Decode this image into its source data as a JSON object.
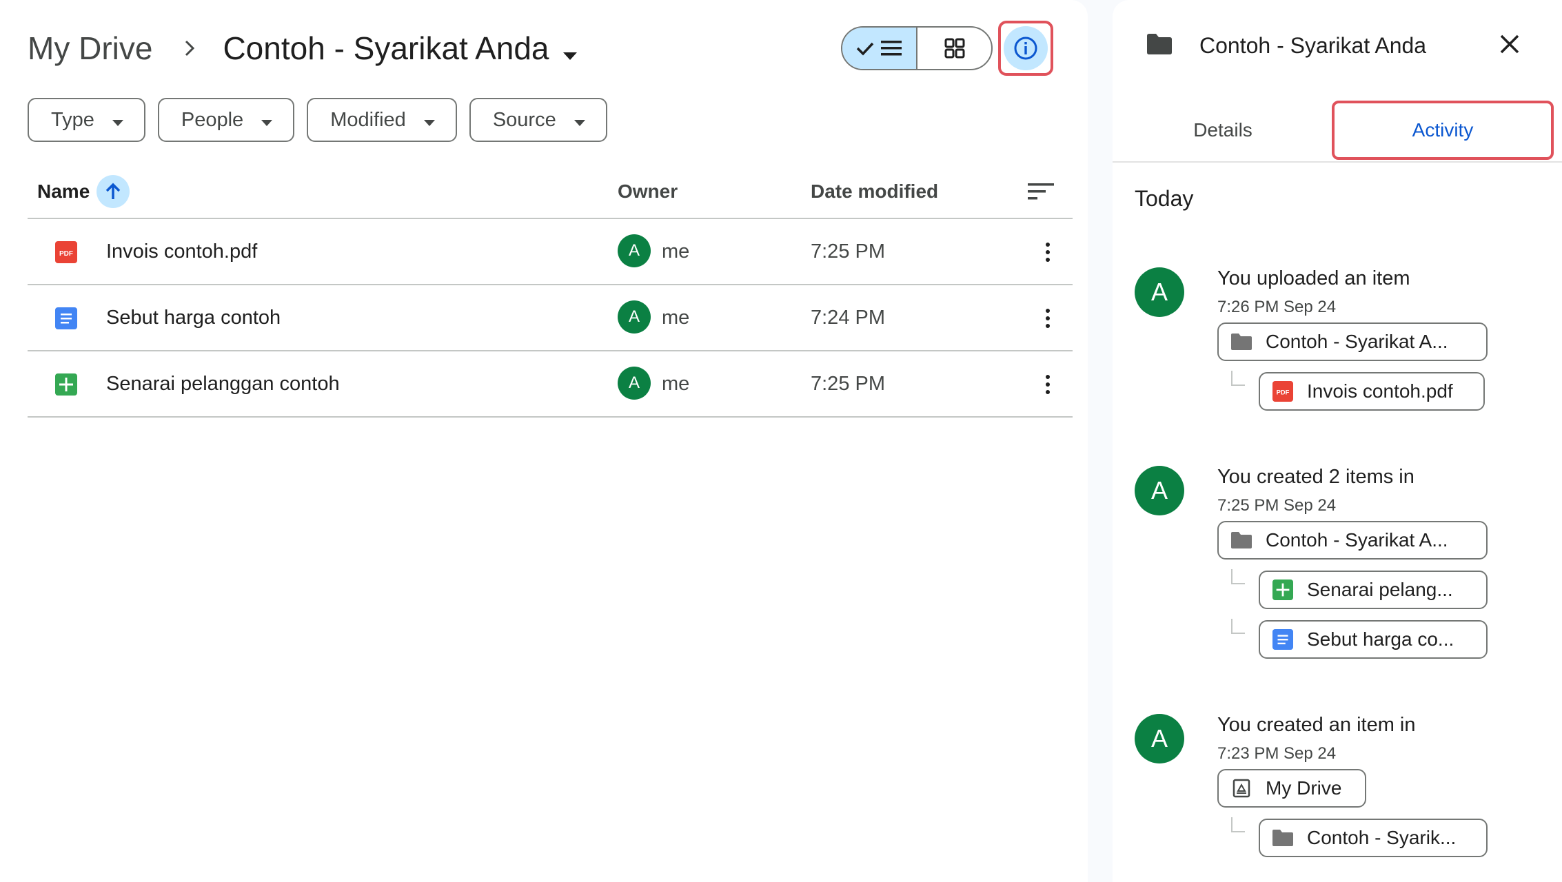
{
  "breadcrumb": {
    "root": "My Drive",
    "current": "Contoh - Syarikat Anda"
  },
  "filters": [
    "Type",
    "People",
    "Modified",
    "Source"
  ],
  "columns": {
    "name": "Name",
    "owner": "Owner",
    "date_modified": "Date modified"
  },
  "files": [
    {
      "name": "Invois contoh.pdf",
      "type": "pdf",
      "owner_initial": "A",
      "owner": "me",
      "modified": "7:25 PM"
    },
    {
      "name": "Sebut harga contoh",
      "type": "docs",
      "owner_initial": "A",
      "owner": "me",
      "modified": "7:24 PM"
    },
    {
      "name": "Senarai pelanggan contoh",
      "type": "sheets",
      "owner_initial": "A",
      "owner": "me",
      "modified": "7:25 PM"
    }
  ],
  "panel": {
    "title": "Contoh - Syarikat Anda",
    "tabs": {
      "details": "Details",
      "activity": "Activity"
    },
    "section_label": "Today",
    "activities": [
      {
        "avatar": "A",
        "title": "You uploaded an item",
        "time": "7:26 PM Sep 24",
        "parent": {
          "label": "Contoh - Syarikat A...",
          "icon": "folder-icon"
        },
        "children": [
          {
            "label": "Invois contoh.pdf",
            "icon": "pdf-icon"
          }
        ]
      },
      {
        "avatar": "A",
        "title": "You created 2 items in",
        "time": "7:25 PM Sep 24",
        "parent": {
          "label": "Contoh - Syarikat A...",
          "icon": "folder-icon"
        },
        "children": [
          {
            "label": "Senarai pelang...",
            "icon": "sheets-icon"
          },
          {
            "label": "Sebut harga co...",
            "icon": "docs-icon"
          }
        ]
      },
      {
        "avatar": "A",
        "title": "You created an item in",
        "time": "7:23 PM Sep 24",
        "parent": {
          "label": "My Drive",
          "icon": "drive-icon"
        },
        "children": [
          {
            "label": "Contoh - Syarik...",
            "icon": "folder-icon"
          }
        ]
      }
    ]
  },
  "colors": {
    "accent": "#0b57d0",
    "selected_bg": "#c2e7ff",
    "avatar": "#0b8043",
    "highlight": "#e0525b"
  }
}
